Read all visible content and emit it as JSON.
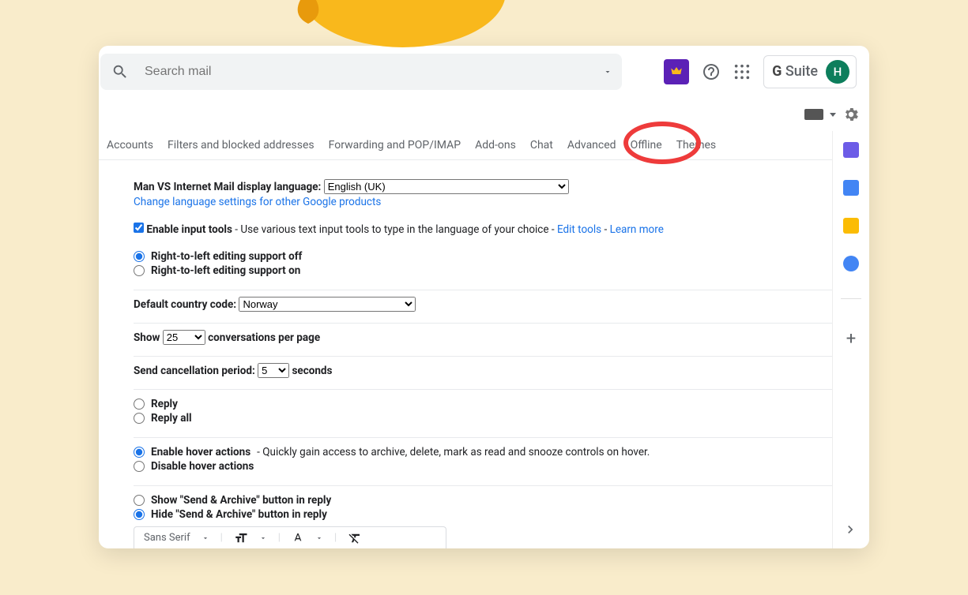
{
  "search": {
    "placeholder": "Search mail"
  },
  "gsuite": {
    "text_g": "G",
    "text_suite": "Suite",
    "avatar": "H"
  },
  "tabs": {
    "accounts": "Accounts",
    "filters": "Filters and blocked addresses",
    "forwarding": "Forwarding and POP/IMAP",
    "addons": "Add-ons",
    "chat": "Chat",
    "advanced": "Advanced",
    "offline": "Offline",
    "themes": "Themes"
  },
  "settings": {
    "lang_label": "Man VS Internet Mail display language:",
    "lang_value": "English (UK)",
    "lang_link": "Change language settings for other Google products",
    "input_tools_label": "Enable input tools",
    "input_tools_desc": " - Use various text input tools to type in the language of your choice - ",
    "edit_tools": "Edit tools",
    "dash": " - ",
    "learn_more": "Learn more",
    "rtl_off": "Right-to-left editing support off",
    "rtl_on": "Right-to-left editing support on",
    "country_label": "Default country code:",
    "country_value": "Norway",
    "show": "Show",
    "page_size": "25",
    "per_page": "conversations per page",
    "cancel_label": "Send cancellation period:",
    "cancel_value": "5",
    "seconds": "seconds",
    "reply": "Reply",
    "reply_all": "Reply all",
    "hover_on": "Enable hover actions",
    "hover_desc": " - Quickly gain access to archive, delete, mark as read and snooze controls on hover.",
    "hover_off": "Disable hover actions",
    "sa_show": "Show \"Send & Archive\" button in reply",
    "sa_hide": "Hide \"Send & Archive\" button in reply"
  },
  "fontbar": {
    "font": "Sans Serif"
  }
}
